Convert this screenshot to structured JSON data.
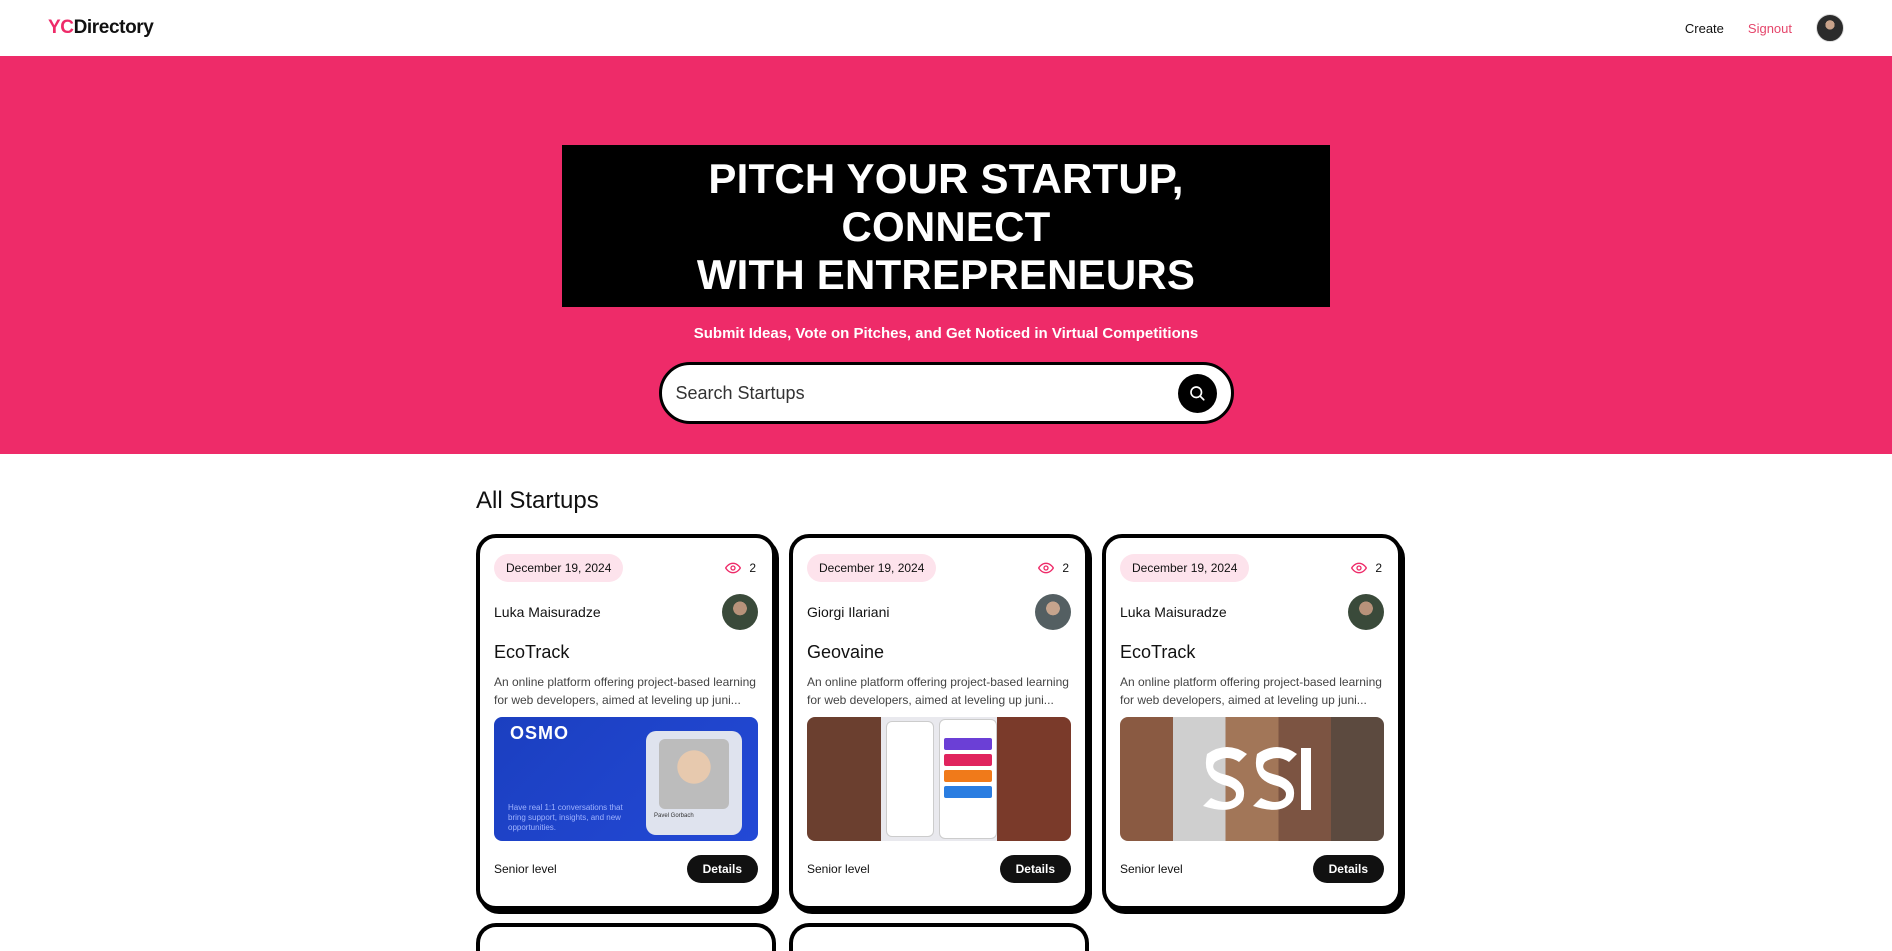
{
  "nav": {
    "logo_yc": "YC",
    "logo_dir": "Directory",
    "create": "Create",
    "signout": "Signout"
  },
  "hero": {
    "title_line1": "PITCH YOUR STARTUP, CONNECT",
    "title_line2": "WITH ENTREPRENEURS",
    "subtitle": "Submit Ideas, Vote on Pitches, and Get Noticed in Virtual Competitions",
    "search_placeholder": "Search Startups"
  },
  "section": {
    "title": "All Startups"
  },
  "cards": [
    {
      "date": "December 19, 2024",
      "views": "2",
      "author": "Luka Maisuradze",
      "title": "EcoTrack",
      "desc": "An online platform offering project-based learning for web developers, aimed at leveling up juni...",
      "level": "Senior level",
      "details": "Details",
      "thumb_text_1": "OSMO",
      "thumb_text_2": "Have real 1:1 conversations that bring support, insights, and new opportunities.",
      "thumb_text_3": "Pavel Gorbach"
    },
    {
      "date": "December 19, 2024",
      "views": "2",
      "author": "Giorgi Ilariani",
      "title": "Geovaine",
      "desc": "An online platform offering project-based learning for web developers, aimed at leveling up juni...",
      "level": "Senior level",
      "details": "Details"
    },
    {
      "date": "December 19, 2024",
      "views": "2",
      "author": "Luka Maisuradze",
      "title": "EcoTrack",
      "desc": "An online platform offering project-based learning for web developers, aimed at leveling up juni...",
      "level": "Senior level",
      "details": "Details"
    }
  ],
  "colors": {
    "brand": "#ee2b69",
    "accent_bg": "#fde3ec",
    "dark": "#000000"
  },
  "icons": {
    "search": "search-icon",
    "views": "eye-icon"
  }
}
